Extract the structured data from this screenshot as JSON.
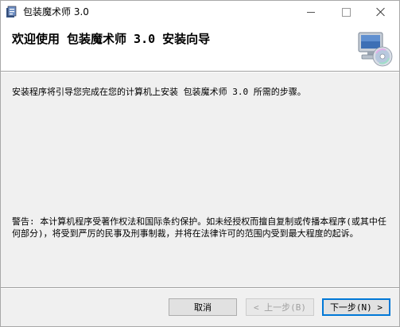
{
  "window": {
    "title": "包装魔术师 3.0",
    "icons": {
      "app": "installer-app-icon",
      "header": "computer-disc-icon"
    }
  },
  "header": {
    "title": "欢迎使用 包装魔术师 3.0 安装向导"
  },
  "body": {
    "intro": "安装程序将引导您完成在您的计算机上安装 包装魔术师 3.0 所需的步骤。",
    "warning": "警告: 本计算机程序受著作权法和国际条约保护。如未经授权而擅自复制或传播本程序(或其中任何部分)，将受到严厉的民事及刑事制裁，并将在法律许可的范围内受到最大程度的起诉。"
  },
  "buttons": {
    "cancel": "取消",
    "back": "< 上一步(B)",
    "next": "下一步(N) >"
  },
  "colors": {
    "accent": "#0078d7",
    "background": "#f0f0f0"
  }
}
